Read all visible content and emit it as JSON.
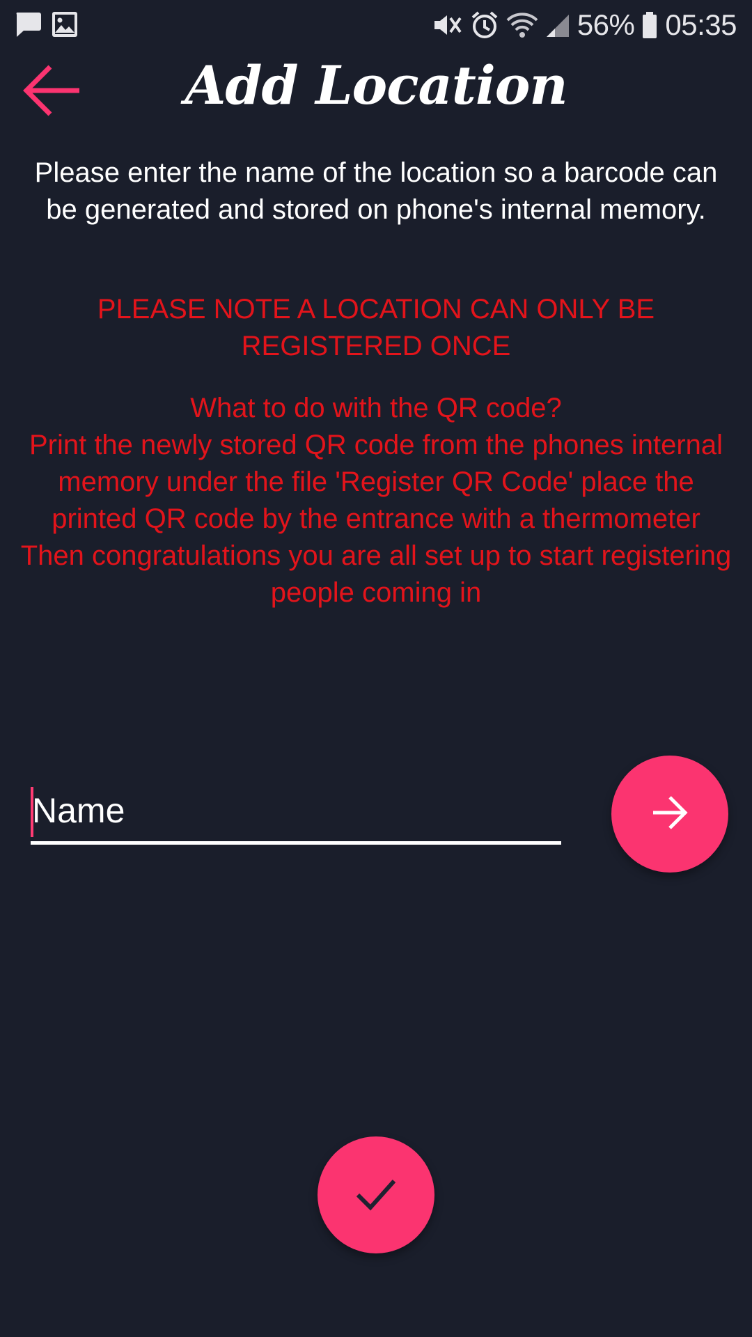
{
  "status_bar": {
    "icons_left": [
      "message-icon",
      "image-icon"
    ],
    "icons_right": [
      "mute-icon",
      "alarm-icon",
      "wifi-icon",
      "signal-icon"
    ],
    "battery_percent": "56%",
    "time": "05:35"
  },
  "header": {
    "title": "Add Location",
    "back_icon": "arrow-left-icon"
  },
  "intro_text": "Please enter the name of the location so a barcode can be generated and stored on phone's internal memory.",
  "warning_text": "PLEASE NOTE A LOCATION CAN ONLY BE REGISTERED ONCE",
  "qr_help": {
    "heading": "What to do with the QR code?",
    "line1": "Print the newly stored QR code from the phones internal memory under the file 'Register QR Code' place the printed QR code by the entrance with a thermometer",
    "line2": "Then congratulations you are all set up to start registering people coming in"
  },
  "name_input": {
    "placeholder": "Name",
    "value": ""
  },
  "buttons": {
    "next_icon": "arrow-right-icon",
    "confirm_icon": "check-icon"
  },
  "colors": {
    "background": "#1a1e2b",
    "accent": "#fb3470",
    "warning_text": "#e3141b",
    "text": "#ffffff"
  }
}
